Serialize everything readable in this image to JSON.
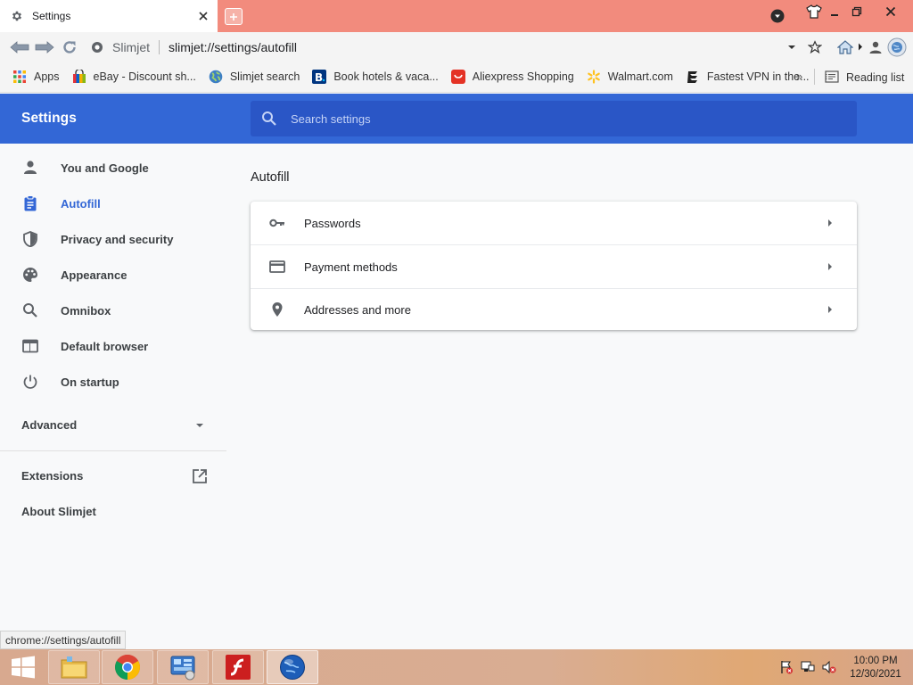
{
  "browser": {
    "tab": {
      "title": "Settings",
      "icon": "gear-icon"
    },
    "address": {
      "site_name": "Slimjet",
      "url": "slimjet://settings/autofill"
    },
    "bookmarks": [
      {
        "label": "Apps",
        "icon": "apps-grid-icon"
      },
      {
        "label": "eBay - Discount sh...",
        "icon": "ebay-icon"
      },
      {
        "label": "Slimjet search",
        "icon": "globe-icon"
      },
      {
        "label": "Book hotels & vaca...",
        "icon": "booking-icon"
      },
      {
        "label": "Aliexpress Shopping",
        "icon": "aliexpress-icon"
      },
      {
        "label": "Walmart.com",
        "icon": "walmart-icon"
      },
      {
        "label": "Fastest VPN in the...",
        "icon": "vpn-icon"
      }
    ],
    "bookmarks_overflow": "»",
    "reading_list": "Reading list"
  },
  "settings": {
    "title": "Settings",
    "search_placeholder": "Search settings",
    "sidebar": {
      "items": [
        {
          "label": "You and Google",
          "icon": "person-icon",
          "active": false
        },
        {
          "label": "Autofill",
          "icon": "clipboard-icon",
          "active": true
        },
        {
          "label": "Privacy and security",
          "icon": "shield-icon",
          "active": false
        },
        {
          "label": "Appearance",
          "icon": "palette-icon",
          "active": false
        },
        {
          "label": "Omnibox",
          "icon": "search-icon",
          "active": false
        },
        {
          "label": "Default browser",
          "icon": "browser-window-icon",
          "active": false
        },
        {
          "label": "On startup",
          "icon": "power-icon",
          "active": false
        }
      ],
      "advanced": "Advanced",
      "extensions": "Extensions",
      "about": "About Slimjet"
    },
    "section_title": "Autofill",
    "rows": [
      {
        "label": "Passwords",
        "icon": "key-icon"
      },
      {
        "label": "Payment methods",
        "icon": "credit-card-icon"
      },
      {
        "label": "Addresses and more",
        "icon": "location-pin-icon"
      }
    ]
  },
  "status_bar": {
    "url": "chrome://settings/autofill"
  },
  "taskbar": {
    "time": "10:00 PM",
    "date": "12/30/2021"
  },
  "colors": {
    "header_blue": "#3367d6",
    "tabstrip": "#f28b7d",
    "active_item": "#3367d6"
  }
}
